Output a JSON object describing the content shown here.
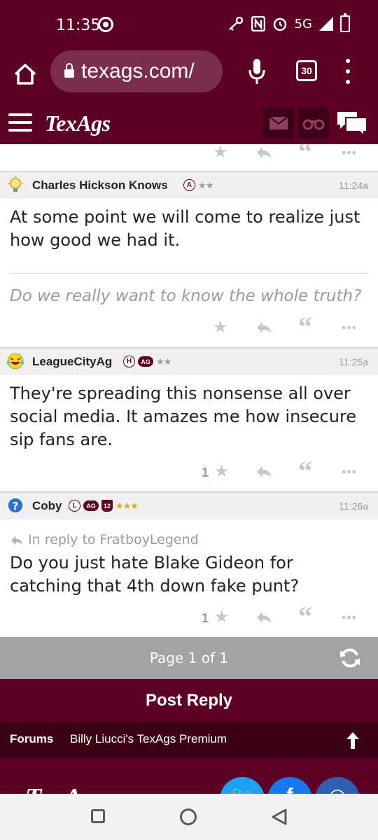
{
  "status_bar": {
    "time": "11:35",
    "network": "5G"
  },
  "browser": {
    "url": "texags.com/",
    "tab_count": "30"
  },
  "site": {
    "logo": "TexAgs"
  },
  "first_post_actions": {},
  "posts": [
    {
      "author": "Charles Hickson Knows",
      "badges": [
        "A"
      ],
      "stars": "★★",
      "time": "11:24a",
      "body": "At some point we will come to realize just how good we had it.",
      "signature": "Do we really want to know the whole truth?"
    },
    {
      "author": "LeagueCityAg",
      "badges": [
        "H",
        "AG"
      ],
      "stars": "★★",
      "time": "11:25a",
      "body": "They're spreading this nonsense all over social media. It amazes me how insecure sip fans are.",
      "star_count": "1"
    },
    {
      "author": "Coby",
      "badges": [
        "L",
        "AG",
        "12"
      ],
      "stars": "★★★",
      "time": "11:26a",
      "in_reply_to": "In reply to FratboyLegend",
      "body": "Do you just hate Blake Gideon for catching that 4th down fake punt?",
      "star_count": "1"
    }
  ],
  "pagination": {
    "label": "Page 1 of 1"
  },
  "post_reply": {
    "label": "Post Reply"
  },
  "breadcrumb": {
    "forums": "Forums",
    "board": "Billy Liucci's TexAgs Premium"
  },
  "footer": {
    "logo": "TexAgs"
  },
  "colors": {
    "maroon": "#5c0025",
    "dark_maroon": "#3a0014",
    "grey_bar": "#a3a3a3"
  }
}
